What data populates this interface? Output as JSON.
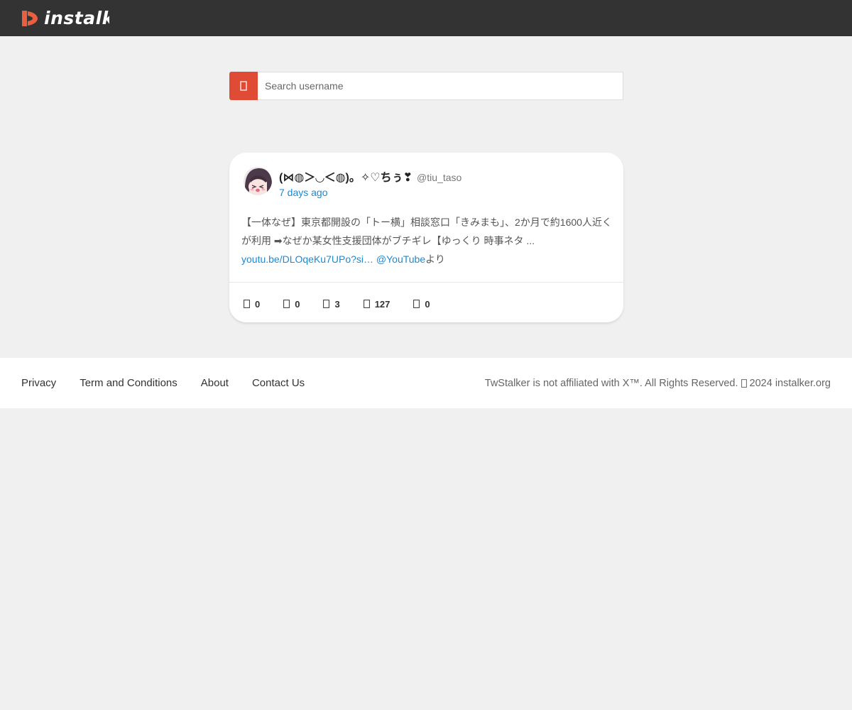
{
  "header": {
    "logo_text": "instalker",
    "logo_color": "#e8603f"
  },
  "search": {
    "placeholder": "Search username",
    "button_icon": "search-icon",
    "button_color": "#e04b35"
  },
  "tweet": {
    "display_name": "(⋈◍＞◡＜◍)。✧♡ちぅ❣",
    "handle": "@tiu_taso",
    "time_ago": "7 days ago",
    "body_text": "【一体なぜ】東京都開設の「トー横」相談窓口「きみまも」、2か月で約1600人近くが利用 ➡なぜか某女性支援団体がブチギレ【ゆっくり 時事ネタ ...",
    "link_text": "youtu.be/DLOqeKu7UPo?si…",
    "mention_text": "@YouTube",
    "suffix_text": "より",
    "link_color": "#1a8ad4",
    "stats": [
      {
        "icon": "reply-icon",
        "value": "0"
      },
      {
        "icon": "retweet-icon",
        "value": "0"
      },
      {
        "icon": "like-icon",
        "value": "3"
      },
      {
        "icon": "views-icon",
        "value": "127"
      },
      {
        "icon": "bookmark-icon",
        "value": "0"
      }
    ]
  },
  "footer": {
    "links": [
      "Privacy",
      "Term and Conditions",
      "About",
      "Contact Us"
    ],
    "copyright_prefix": "TwStalker is not affiliated with X™. All Rights Reserved.",
    "copyright_suffix": "2024 instalker.org"
  }
}
